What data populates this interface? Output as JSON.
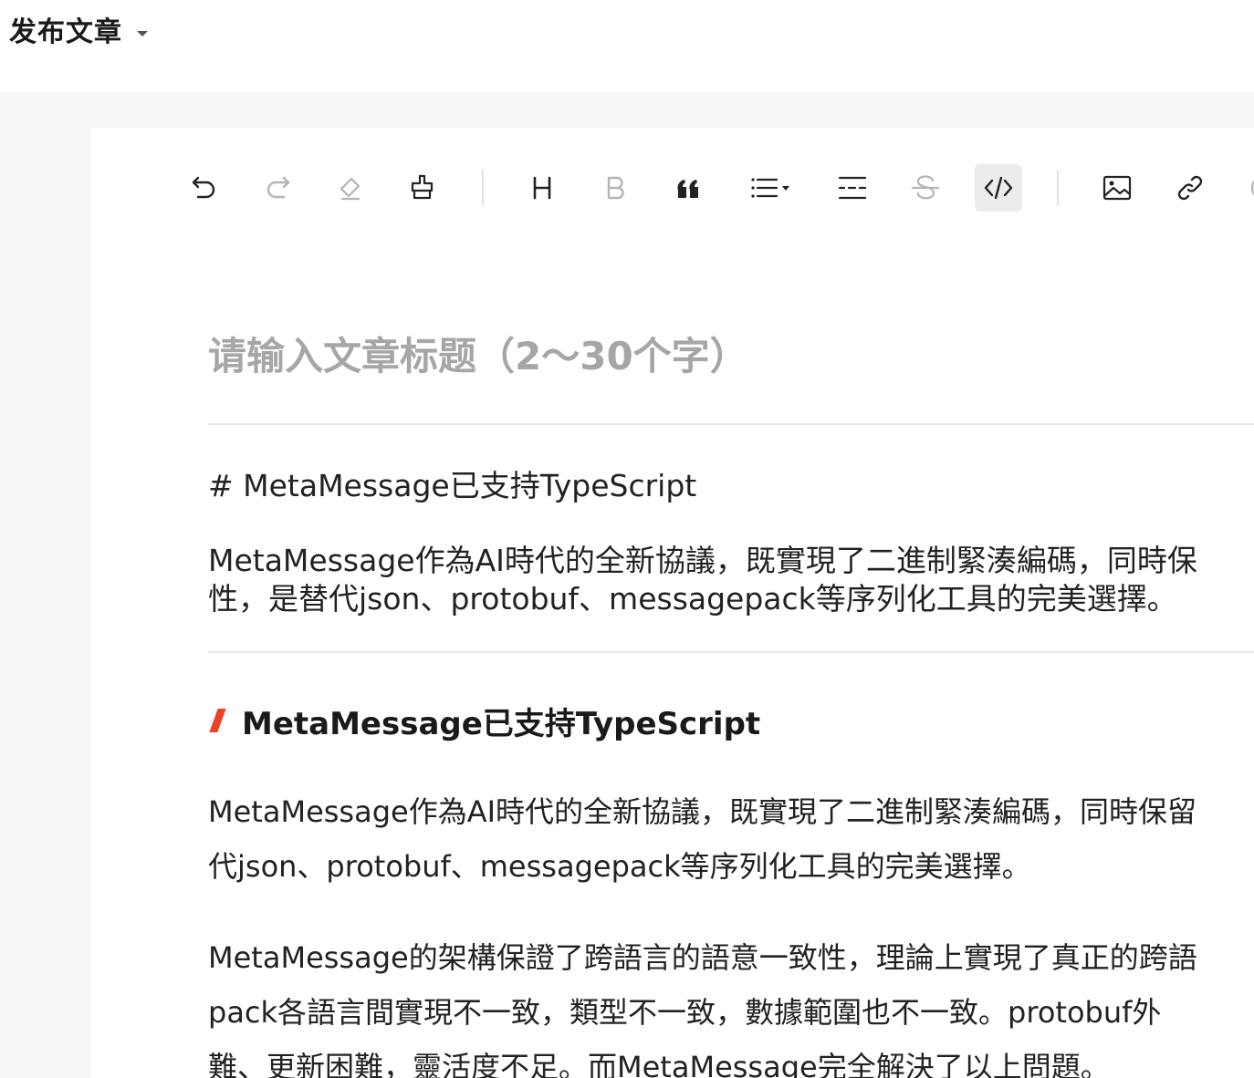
{
  "header": {
    "publish_label": "发布文章"
  },
  "toolbar": {
    "buttons": [
      {
        "name": "undo-button",
        "icon": "undo-icon"
      },
      {
        "name": "redo-button",
        "icon": "redo-icon"
      },
      {
        "name": "clear-format-button",
        "icon": "eraser-icon"
      },
      {
        "name": "format-painter-button",
        "icon": "format-painter-icon"
      },
      {
        "name": "heading-button",
        "icon": "heading-icon"
      },
      {
        "name": "bold-button",
        "icon": "bold-icon"
      },
      {
        "name": "quote-button",
        "icon": "quote-icon"
      },
      {
        "name": "list-button",
        "icon": "list-icon"
      },
      {
        "name": "divider-button",
        "icon": "divider-icon"
      },
      {
        "name": "strikethrough-button",
        "icon": "strikethrough-icon"
      },
      {
        "name": "code-button",
        "icon": "code-icon",
        "active": true
      },
      {
        "name": "image-button",
        "icon": "image-icon"
      },
      {
        "name": "link-button",
        "icon": "link-icon"
      }
    ]
  },
  "editor": {
    "title_placeholder": "请输入文章标题（2～30个字）",
    "source": {
      "heading_line": "# MetaMessage已支持TypeScript",
      "paragraph_lines": [
        "MetaMessage作為AI時代的全新協議，既實現了二進制緊湊編碼，同時保",
        "性，是替代json、protobuf、messagepack等序列化工具的完美選擇。"
      ]
    },
    "preview": {
      "heading": "MetaMessage已支持TypeScript",
      "paragraph1_lines": [
        "MetaMessage作為AI時代的全新協議，既實現了二進制緊湊編碼，同時保留",
        "代json、protobuf、messagepack等序列化工具的完美選擇。"
      ],
      "paragraph2_lines": [
        "MetaMessage的架構保證了跨語言的語意一致性，理論上實現了真正的跨語",
        "pack各語言間實現不一致，類型不一致，數據範圍也不一致。protobuf外",
        "難、更新困難，靈活度不足。而MetaMessage完全解決了以上問題。"
      ]
    }
  },
  "colors": {
    "accent": "#e8432b",
    "workspace_bg": "#f7f7f7",
    "active_button_bg": "#ececec",
    "placeholder": "#a6a6a6"
  }
}
